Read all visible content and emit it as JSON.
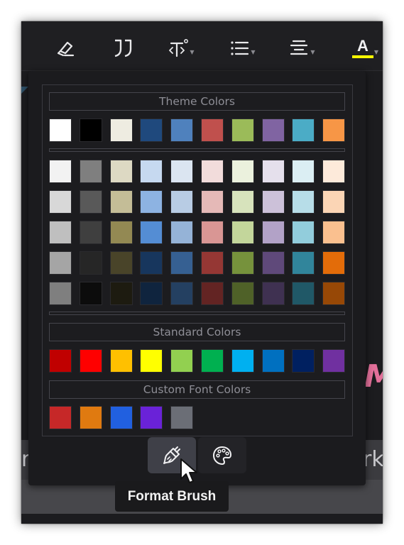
{
  "toolbar": {
    "items": [
      {
        "icon": "eraser-icon"
      },
      {
        "icon": "quote-icon"
      },
      {
        "icon": "text-size-icon",
        "has_dropdown": true
      },
      {
        "icon": "bulleted-list-icon",
        "has_dropdown": true
      },
      {
        "icon": "align-center-icon",
        "has_dropdown": true
      },
      {
        "icon": "font-color-icon",
        "has_dropdown": true,
        "letter": "A",
        "color": "#ffff00"
      }
    ]
  },
  "background": {
    "left_text": "rt",
    "right_text": "rk",
    "accent_letter": "M",
    "accent_color": "#e3709a"
  },
  "color_picker": {
    "theme_title": "Theme Colors",
    "theme_row": [
      "#ffffff",
      "#000000",
      "#eeece1",
      "#1f497d",
      "#4f81bd",
      "#c0504d",
      "#9bbb59",
      "#8064a2",
      "#4bacc6",
      "#f79646"
    ],
    "shade_rows": [
      [
        "#f2f2f2",
        "#7f7f7f",
        "#ddd9c3",
        "#c6d9f0",
        "#dbe5f1",
        "#f2dcdb",
        "#ebf1dd",
        "#e5e0ec",
        "#dbeef3",
        "#fdeada"
      ],
      [
        "#d8d8d8",
        "#595959",
        "#c4bd97",
        "#8db3e2",
        "#b8cce4",
        "#e5b9b7",
        "#d7e3bc",
        "#ccc1d9",
        "#b7dde8",
        "#fbd5b5"
      ],
      [
        "#bfbfbf",
        "#3f3f3f",
        "#938953",
        "#548dd4",
        "#95b3d7",
        "#d99694",
        "#c3d69b",
        "#b2a2c7",
        "#92cddc",
        "#fac08f"
      ],
      [
        "#a5a5a5",
        "#262626",
        "#494429",
        "#17365d",
        "#366092",
        "#953734",
        "#76923c",
        "#5f497a",
        "#31859b",
        "#e36c09"
      ],
      [
        "#7f7f7f",
        "#0c0c0c",
        "#1d1b10",
        "#0f243e",
        "#244061",
        "#632423",
        "#4f6128",
        "#3f3151",
        "#205867",
        "#974806"
      ]
    ],
    "standard_title": "Standard Colors",
    "standard_row": [
      "#c00000",
      "#ff0000",
      "#ffc000",
      "#ffff00",
      "#92d050",
      "#00b050",
      "#00b0f0",
      "#0070c0",
      "#002060",
      "#7030a0"
    ],
    "custom_title": "Custom Font Colors",
    "custom_row": [
      "#c62828",
      "#e07a10",
      "#2160e0",
      "#6a22d8",
      "#6b6e76"
    ]
  },
  "tabs": [
    {
      "name": "format-brush-tab",
      "icon": "paintbrush-icon",
      "active": true
    },
    {
      "name": "palette-tab",
      "icon": "palette-icon",
      "active": false
    }
  ],
  "tooltip": {
    "label": "Format Brush"
  }
}
